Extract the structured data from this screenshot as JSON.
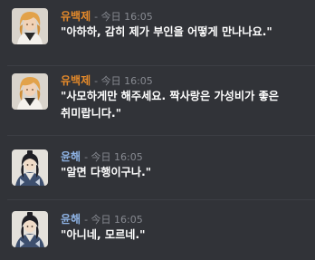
{
  "colors": {
    "background": "#313338",
    "divider": "#3c3e44",
    "timestamp": "#878a91",
    "message_text": "#ffffff"
  },
  "messages": [
    {
      "author": "유백제",
      "author_color": "#e58a2a",
      "avatar_icon": "blonde-character-avatar-icon",
      "timestamp": "- 今日 16:05",
      "text": "\"아하하, 감히 제가 부인을 어떻게 만나나요.\""
    },
    {
      "author": "유백제",
      "author_color": "#e58a2a",
      "avatar_icon": "blonde-character-avatar-icon",
      "timestamp": "- 今日 16:05",
      "text": "\"사모하게만 해주세요. 짝사랑은 가성비가 좋은 취미랍니다.\""
    },
    {
      "author": "윤해",
      "author_color": "#8fb4e6",
      "avatar_icon": "dark-haired-character-avatar-icon",
      "timestamp": "- 今日 16:05",
      "text": "\"알면 다행이구나.\""
    },
    {
      "author": "윤해",
      "author_color": "#8fb4e6",
      "avatar_icon": "dark-haired-character-avatar-icon",
      "timestamp": "- 今日 16:05",
      "text": "\"아니네, 모르네.\""
    }
  ]
}
